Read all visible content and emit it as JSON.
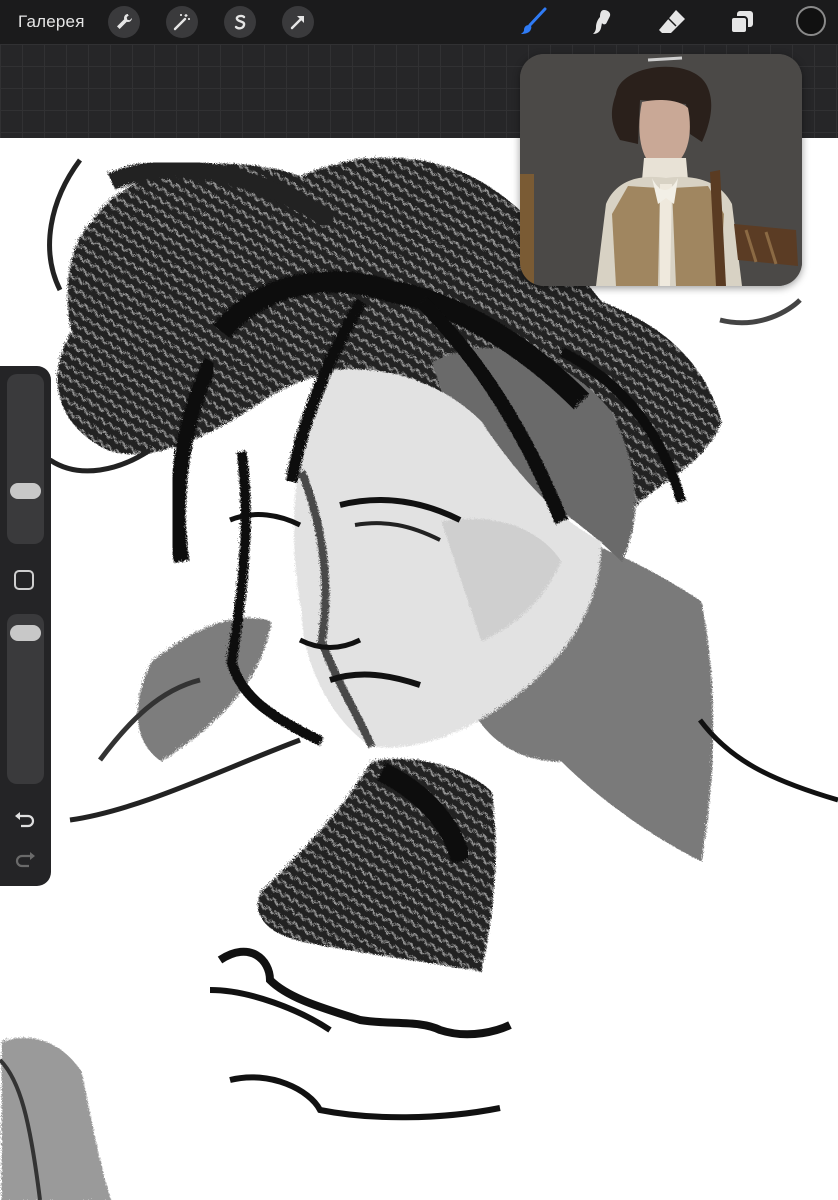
{
  "toolbar": {
    "gallery_label": "Галерея",
    "left_icons": [
      "wrench-icon",
      "magic-wand-icon",
      "selection-s-icon",
      "transform-arrow-icon"
    ],
    "right_tools": [
      "brush-icon",
      "smudge-icon",
      "eraser-icon",
      "layers-icon",
      "color-icon"
    ],
    "active_tool": "brush",
    "active_color": "#2f7bf5",
    "current_color": "#111111"
  },
  "sidebar": {
    "brush_size_level": 0.72,
    "opacity_level": 0.05,
    "buttons": [
      "modify-icon",
      "undo-icon",
      "redo-icon"
    ]
  },
  "reference": {
    "description_icon": "reference-image-icon"
  }
}
